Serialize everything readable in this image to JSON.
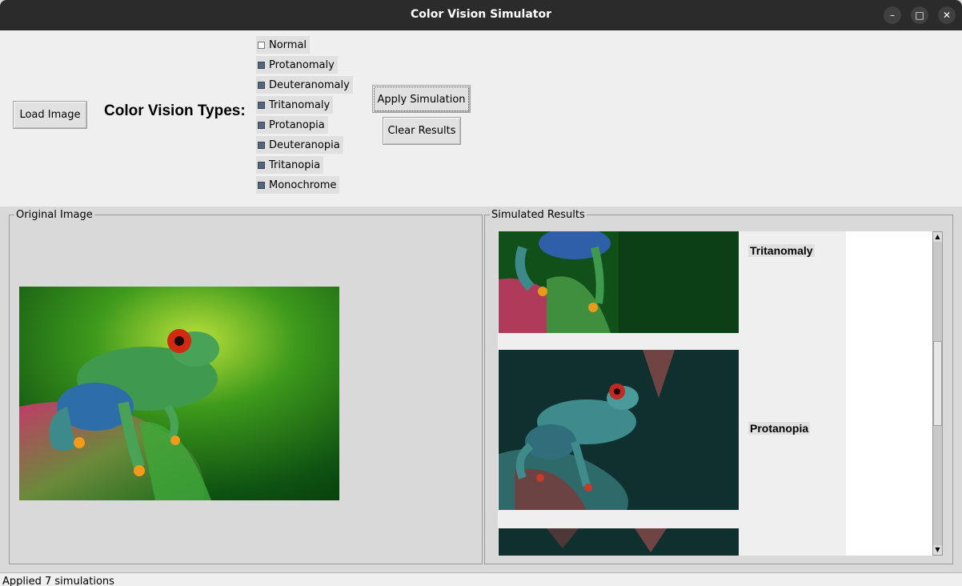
{
  "window": {
    "title": "Color Vision Simulator"
  },
  "controls": {
    "load_label": "Load Image",
    "types_label": "Color Vision Types:",
    "apply_label": "Apply Simulation",
    "clear_label": "Clear Results",
    "types": [
      {
        "label": "Normal",
        "checked": false
      },
      {
        "label": "Protanomaly",
        "checked": true
      },
      {
        "label": "Deuteranomaly",
        "checked": true
      },
      {
        "label": "Tritanomaly",
        "checked": true
      },
      {
        "label": "Protanopia",
        "checked": true
      },
      {
        "label": "Deuteranopia",
        "checked": true
      },
      {
        "label": "Tritanopia",
        "checked": true
      },
      {
        "label": "Monochrome",
        "checked": true
      }
    ]
  },
  "original": {
    "frame_title": "Original Image"
  },
  "results": {
    "frame_title": "Simulated Results",
    "items": [
      {
        "label": "Tritanomaly"
      },
      {
        "label": "Protanopia"
      }
    ]
  },
  "status": {
    "text": "Applied 7 simulations"
  },
  "colors": {
    "titlebar": "#2b2b2b",
    "panel": "#efefef",
    "checkbox": "#55657a"
  }
}
